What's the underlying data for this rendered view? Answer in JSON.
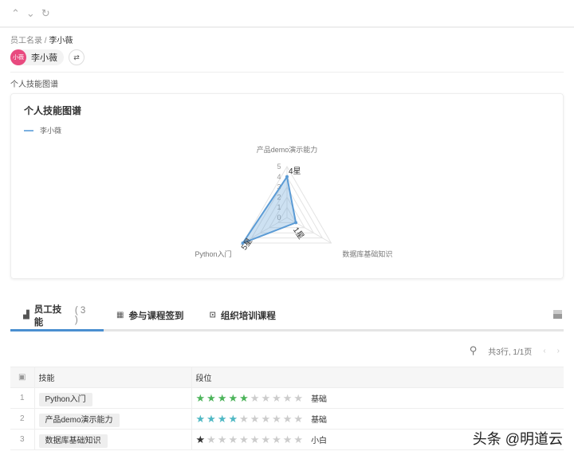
{
  "toolbar": {
    "up": "^",
    "down": "v",
    "refresh": "↻"
  },
  "breadcrumb": {
    "parent": "员工名录",
    "sep": "/",
    "current": "李小薇"
  },
  "user": {
    "avatar_text": "小薇",
    "name": "李小薇",
    "avatar_color": "#e84a7f"
  },
  "section_title": "个人技能图谱",
  "card": {
    "title": "个人技能图谱",
    "legend": "李小薇"
  },
  "chart_data": {
    "type": "radar",
    "title": "个人技能图谱",
    "legend": [
      "李小薇"
    ],
    "axes": [
      "产品demo演示能力",
      "数据库基础知识",
      "Python入门"
    ],
    "values": [
      4,
      1,
      5
    ],
    "value_labels": [
      "4星",
      "1星",
      "5星"
    ],
    "range": [
      0,
      5
    ],
    "ticks": [
      "0",
      "1",
      "2",
      "3",
      "4",
      "5"
    ],
    "color": "#5b9bd5"
  },
  "tabs": [
    {
      "label": "员工技能",
      "count": "( 3 )",
      "icon": "building-icon"
    },
    {
      "label": "参与课程签到",
      "icon": "calendar-icon"
    },
    {
      "label": "组织培训课程",
      "icon": "training-icon"
    }
  ],
  "pager": {
    "summary": "共3行, 1/1页",
    "prev": "‹",
    "next": "›"
  },
  "table": {
    "headers": [
      "技能",
      "段位"
    ],
    "rows": [
      {
        "n": "1",
        "skill": "Python入门",
        "stars": 5,
        "color": "#4cb45a",
        "level": "基础"
      },
      {
        "n": "2",
        "skill": "产品demo演示能力",
        "stars": 4,
        "color": "#4fb8c4",
        "level": "基础"
      },
      {
        "n": "3",
        "skill": "数据库基础知识",
        "stars": 1,
        "color": "#333333",
        "level": "小白"
      }
    ]
  },
  "watermark": "头条 @明道云"
}
